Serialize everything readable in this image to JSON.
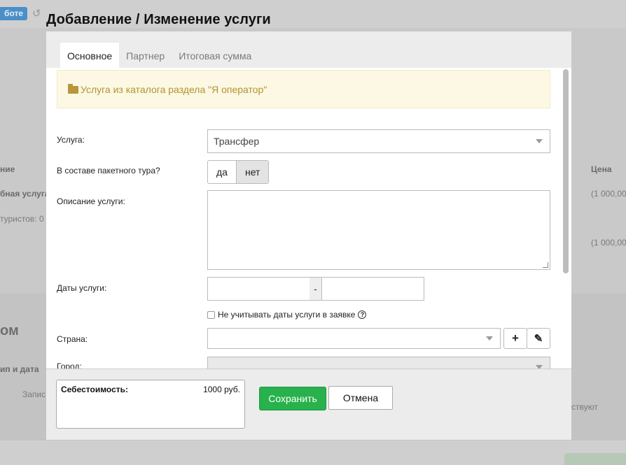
{
  "background": {
    "top_badge": "боте",
    "col_name": "ние",
    "col_price": "Цена",
    "row_service": "бная услуга",
    "row_detail": "туристов: 0",
    "price_1": "(1 000,00",
    "price_2": "(1 000,00",
    "section_heading": "ом",
    "section_sub": "ип и дата",
    "section_item": "Запис",
    "section_status": "ствуют"
  },
  "modal": {
    "title": "Добавление / Изменение услуги",
    "tabs": [
      {
        "label": "Основное",
        "active": true
      },
      {
        "label": "Партнер",
        "active": false
      },
      {
        "label": "Итоговая сумма",
        "active": false
      }
    ],
    "notice": {
      "icon": "folder-icon",
      "text": "Услуга из каталога раздела \"Я оператор\""
    },
    "form": {
      "service_label": "Услуга:",
      "service_value": "Трансфер",
      "package_label": "В составе пакетного тура?",
      "package_yes": "да",
      "package_no": "нет",
      "package_selected": "нет",
      "description_label": "Описание услуги:",
      "description_value": "",
      "dates_label": "Даты услуги:",
      "date_from": "",
      "date_separator": "-",
      "date_to": "",
      "ignore_dates_label": "Не учитывать даты услуги в заявке",
      "ignore_dates_checked": false,
      "help_icon": "?",
      "country_label": "Страна:",
      "country_value": "",
      "add_icon": "+",
      "edit_icon": "✎",
      "city_label": "Город:",
      "city_value": ""
    },
    "footer": {
      "cost_label": "Себестоимость:",
      "cost_value": "1000 руб.",
      "save_label": "Сохранить",
      "cancel_label": "Отмена"
    }
  },
  "colors": {
    "save_button": "#28b14c",
    "notice_bg": "#fcf8e3",
    "notice_text": "#b3922f"
  }
}
